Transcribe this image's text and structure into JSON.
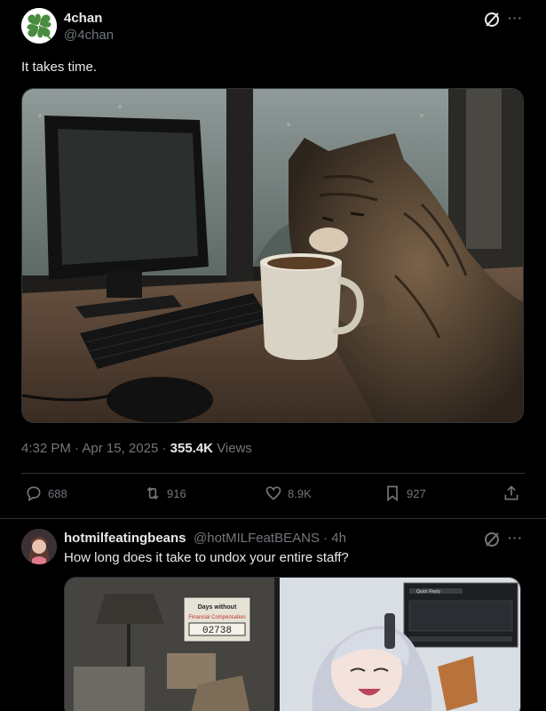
{
  "post": {
    "author_name": "4chan",
    "author_handle": "@4chan",
    "text": "It takes time.",
    "time": "4:32 PM",
    "date": "Apr 15, 2025",
    "views_count": "355.4K",
    "views_label": "Views",
    "replies": "688",
    "reposts": "916",
    "likes": "8.9K",
    "bookmarks": "927",
    "more_label": "···"
  },
  "reply": {
    "author_name": "hotmilfeatingbeans",
    "author_handle": "@hotMILFeatBEANS",
    "age": "4h",
    "text": "How long does it take to undox your entire staff?",
    "more_label": "···",
    "image_sign_title": "Days without",
    "image_sign_subtitle": "Financial Compensation",
    "image_counter": "02738",
    "image_window_button": "Quick Reply"
  },
  "colors": {
    "background": "#000000",
    "text_primary": "#e7e9ea",
    "text_secondary": "#71767b",
    "border": "#2f3336",
    "logo_green": "#4a8c3f"
  },
  "icons": [
    "grok-icon",
    "reply-icon",
    "repost-icon",
    "like-icon",
    "bookmark-icon",
    "share-icon",
    "more-icon",
    "clover-logo-icon"
  ]
}
